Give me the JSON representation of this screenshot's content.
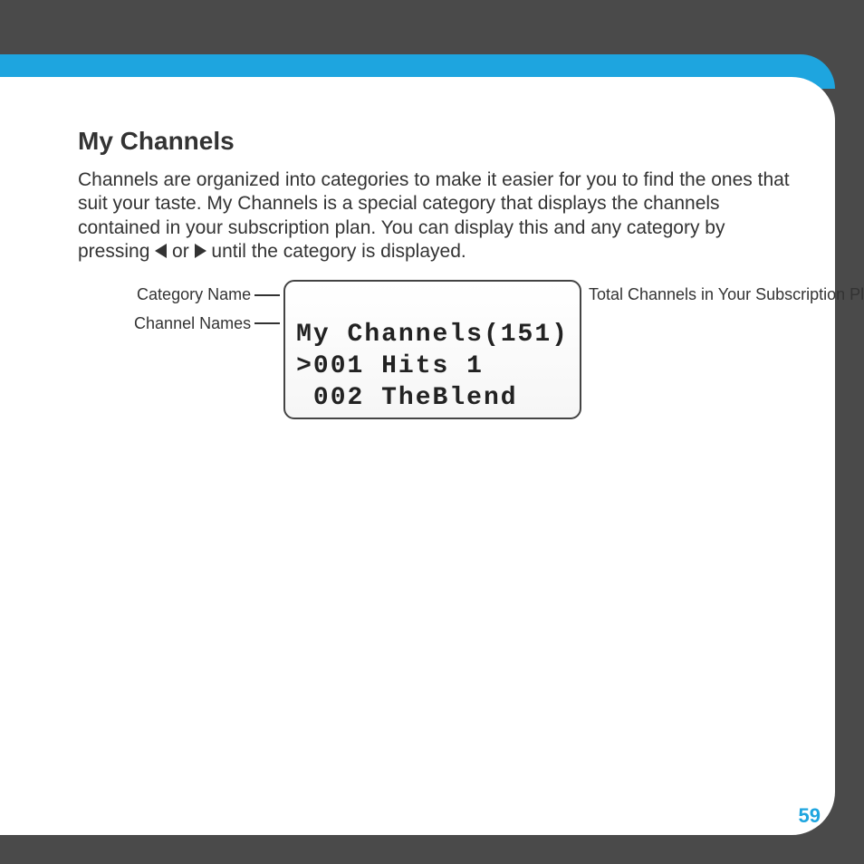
{
  "page": {
    "number": "59"
  },
  "heading": "My Channels",
  "body": {
    "part1": "Channels are organized into categories to make it easier for you to find the ones that suit your taste. My Channels is a special category that displays the channels contained in your subscription plan. You can display this and any category by pressing ",
    "or": " or ",
    "part2": " until the category is displayed."
  },
  "labels": {
    "category_name": "Category Name",
    "channel_names": "Channel Names",
    "total_channels": "Total Channels in Your Subscription Plan"
  },
  "lcd": {
    "line1": "My Channels(151)",
    "line2": ">001 Hits 1",
    "line3": " 002 TheBlend"
  }
}
